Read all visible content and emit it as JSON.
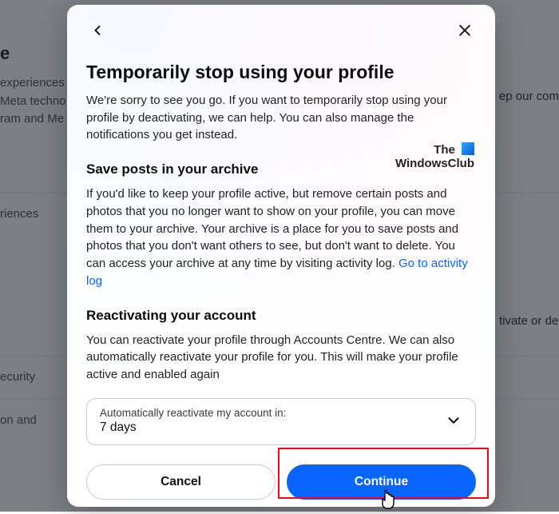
{
  "background": {
    "heading_fragment": "e",
    "line1": "experiences",
    "line2": "Meta techno",
    "line3": "ram and Me",
    "row1": "riences",
    "row2": "ecurity",
    "row3": "on and",
    "right1": "ep our com",
    "right2": "tivate or de"
  },
  "modal": {
    "title": "Temporarily stop using your profile",
    "intro": "We're sorry to see you go. If you want to temporarily stop using your profile by deactivating, we can help. You can also manage the notifications you get instead.",
    "save_heading": "Save posts in your archive",
    "save_body_before_link": "If you'd like to keep your profile active, but remove certain posts and photos that you no longer want to show on your profile, you can move them to your archive. Your archive is a place for you to save posts and photos that you don't want others to see, but don't want to delete. You can access your archive at any time by visiting activity log. ",
    "save_link": "Go to activity log",
    "react_heading": "Reactivating your account",
    "react_body": "You can reactivate your profile through Accounts Centre. We can also automatically reactivate your profile for you. This will make your profile active and enabled again",
    "select_label": "Automatically reactivate my account in:",
    "select_value": "7 days",
    "cancel": "Cancel",
    "continue": "Continue"
  },
  "watermark": {
    "line1": "The",
    "line2": "WindowsClub"
  }
}
